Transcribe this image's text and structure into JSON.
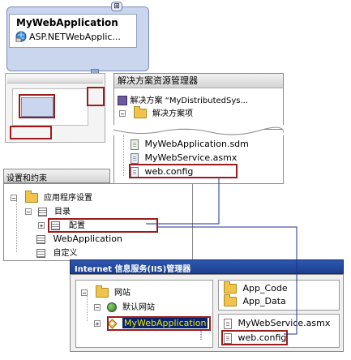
{
  "app_component": {
    "title": "MyWebApplication",
    "subtitle": "ASP.NETWebApplic..."
  },
  "solution_explorer": {
    "title": "解决方案资源管理器",
    "solution_label": "解决方案 “MyDistributedSys...",
    "solution_items": "解决方案项",
    "files": [
      "MyWebApplication.sdm",
      "MyWebService.asmx",
      "web.config"
    ]
  },
  "settings_panel": {
    "title": "设置和约束",
    "items": [
      "应用程序设置",
      "目录",
      "配置",
      "WebApplication",
      "自定义"
    ]
  },
  "iis_panel": {
    "title": "Internet 信息服务(IIS)管理器",
    "tree": [
      "网站",
      "默认网站",
      "MyWebApplication"
    ],
    "folders": [
      "App_Code",
      "App_Data"
    ],
    "files": [
      "MyWebService.asmx",
      "web.config"
    ]
  },
  "colors": {
    "accent_red": "#9b1c1c",
    "connector_blue": "#1f2f8a",
    "iis_title_bg": "#1d3f8f",
    "selection_bg": "#0a246a"
  }
}
